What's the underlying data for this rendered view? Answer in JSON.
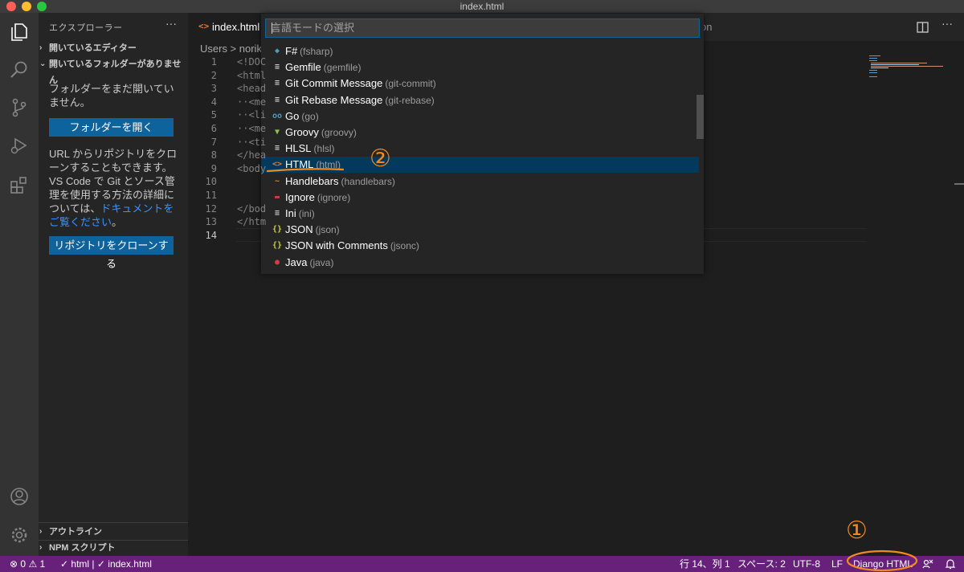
{
  "window": {
    "title": "index.html"
  },
  "sidebar": {
    "title": "エクスプローラー",
    "more": "···",
    "open_editors": "開いているエディター",
    "no_folder": "開いているフォルダーがありません",
    "no_folder_msg": "フォルダーをまだ開いていません。",
    "open_folder_button": "フォルダーを開く",
    "clone_msg_1": "URL からリポジトリをクローンすることもできます。VS Code で Git とソース管理を使用する方法の詳細については、",
    "clone_msg_link": "ドキュメントをご覧ください",
    "clone_msg_end": "。",
    "clone_button": "リポジトリをクローンする",
    "outline": "アウトライン",
    "npm_scripts": "NPM スクリプト"
  },
  "tabs": {
    "active_label": "index.html",
    "active_icon": "<>",
    "hidden_fragment": "on"
  },
  "breadcrumb": "Users > norik",
  "editor": {
    "line_numbers": [
      "1",
      "2",
      "3",
      "4",
      "5",
      "6",
      "7",
      "8",
      "9",
      "10",
      "11",
      "12",
      "13",
      "14"
    ],
    "lines": [
      "<!DOC",
      "<html",
      "<head",
      "··<me",
      "··<li",
      "··<me",
      "··<ti",
      "</hea",
      "<body",
      "",
      "",
      "</bod",
      "</htm",
      ""
    ]
  },
  "quickpick": {
    "placeholder": "言語モードの選択",
    "items": [
      {
        "label": "F#",
        "id": "(fsharp)",
        "icon": "fsharp-icon",
        "glyph": "◆",
        "color": "#519aba"
      },
      {
        "label": "Gemfile",
        "id": "(gemfile)",
        "icon": "lines-icon",
        "glyph": "≡",
        "color": "#cccccc"
      },
      {
        "label": "Git Commit Message",
        "id": "(git-commit)",
        "icon": "lines-icon",
        "glyph": "≡",
        "color": "#cccccc"
      },
      {
        "label": "Git Rebase Message",
        "id": "(git-rebase)",
        "icon": "lines-icon",
        "glyph": "≡",
        "color": "#cccccc"
      },
      {
        "label": "Go",
        "id": "(go)",
        "icon": "go-icon",
        "glyph": "oo",
        "color": "#519aba"
      },
      {
        "label": "Groovy",
        "id": "(groovy)",
        "icon": "groovy-icon",
        "glyph": "▼",
        "color": "#8dc149"
      },
      {
        "label": "HLSL",
        "id": "(hlsl)",
        "icon": "lines-icon",
        "glyph": "≡",
        "color": "#cccccc"
      },
      {
        "label": "HTML",
        "id": "(html)",
        "icon": "html-icon",
        "glyph": "<>",
        "color": "#e37933"
      },
      {
        "label": "Handlebars",
        "id": "(handlebars)",
        "icon": "handlebars-icon",
        "glyph": "~",
        "color": "#e37933"
      },
      {
        "label": "Ignore",
        "id": "(ignore)",
        "icon": "ignore-icon",
        "glyph": "▬",
        "color": "#cc3e44"
      },
      {
        "label": "Ini",
        "id": "(ini)",
        "icon": "lines-icon",
        "glyph": "≡",
        "color": "#cccccc"
      },
      {
        "label": "JSON",
        "id": "(json)",
        "icon": "json-icon",
        "glyph": "{}",
        "color": "#cbcb41"
      },
      {
        "label": "JSON with Comments",
        "id": "(jsonc)",
        "icon": "json-icon",
        "glyph": "{}",
        "color": "#cbcb41"
      },
      {
        "label": "Java",
        "id": "(java)",
        "icon": "java-icon",
        "glyph": "●",
        "color": "#cc3e44"
      }
    ],
    "selected_index": 7
  },
  "statusbar": {
    "errors": "0",
    "warnings": "1",
    "check_html": "html",
    "check_file": "index.html",
    "position": "行 14、列 1",
    "spaces": "スペース: 2",
    "encoding": "UTF-8",
    "eol": "LF",
    "language": "Django HTML"
  },
  "annotations": {
    "one": "①",
    "two": "②",
    "color": "#f28b1d"
  }
}
